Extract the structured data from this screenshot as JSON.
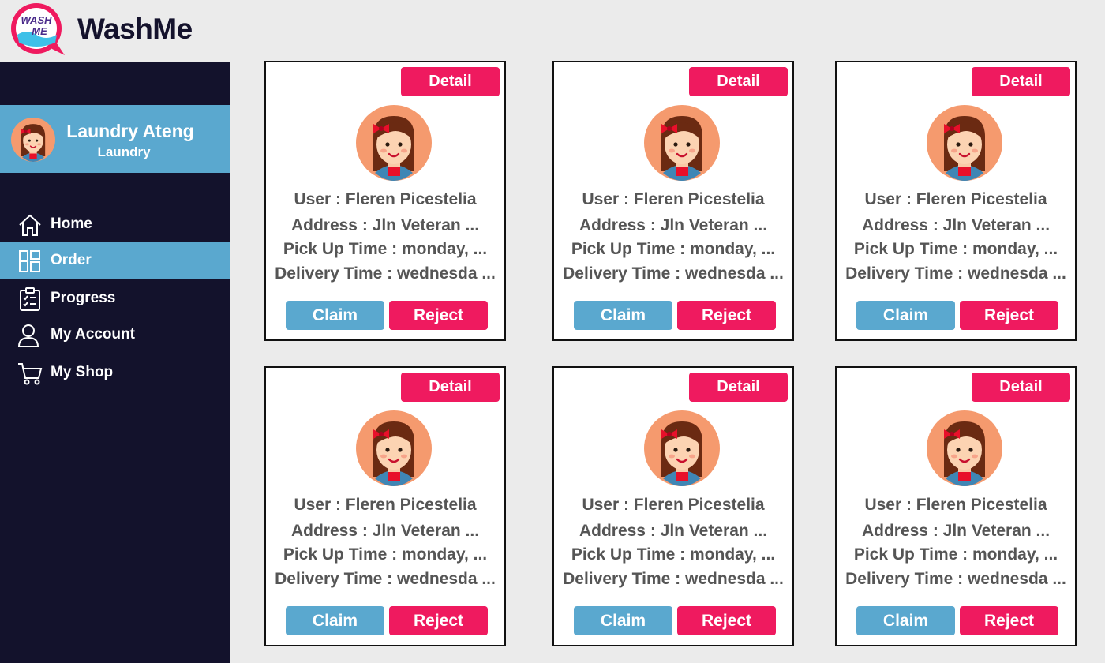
{
  "app": {
    "brand": "WashMe",
    "logo_text": "WASH ME"
  },
  "colors": {
    "sidebar_bg": "#13122c",
    "accent_blue": "#5aa8cf",
    "accent_pink": "#ef1a5f",
    "page_bg": "#ebebeb"
  },
  "profile": {
    "name": "Laundry Ateng",
    "role": "Laundry"
  },
  "nav": {
    "items": [
      {
        "label": "Home",
        "icon": "home-icon",
        "active": false
      },
      {
        "label": "Order",
        "icon": "dashboard-icon",
        "active": true
      },
      {
        "label": "Progress",
        "icon": "clipboard-icon",
        "active": false
      },
      {
        "label": "My Account",
        "icon": "user-icon",
        "active": false
      },
      {
        "label": "My Shop",
        "icon": "cart-icon",
        "active": false
      }
    ]
  },
  "orders": [
    {
      "detail_label": "Detail",
      "user": "User : Fleren Picestelia",
      "address": "Address : Jln Veteran ...",
      "pickup": "Pick Up Time : monday, ...",
      "delivery": "Delivery Time : wednesda ...",
      "claim_label": "Claim",
      "reject_label": "Reject"
    },
    {
      "detail_label": "Detail",
      "user": "User : Fleren Picestelia",
      "address": "Address : Jln Veteran ...",
      "pickup": "Pick Up Time : monday, ...",
      "delivery": "Delivery Time : wednesda ...",
      "claim_label": "Claim",
      "reject_label": "Reject"
    },
    {
      "detail_label": "Detail",
      "user": "User : Fleren Picestelia",
      "address": "Address : Jln Veteran ...",
      "pickup": "Pick Up Time : monday, ...",
      "delivery": "Delivery Time : wednesda ...",
      "claim_label": "Claim",
      "reject_label": "Reject"
    },
    {
      "detail_label": "Detail",
      "user": "User : Fleren Picestelia",
      "address": "Address : Jln Veteran ...",
      "pickup": "Pick Up Time : monday, ...",
      "delivery": "Delivery Time : wednesda ...",
      "claim_label": "Claim",
      "reject_label": "Reject"
    },
    {
      "detail_label": "Detail",
      "user": "User : Fleren Picestelia",
      "address": "Address : Jln Veteran ...",
      "pickup": "Pick Up Time : monday, ...",
      "delivery": "Delivery Time : wednesda ...",
      "claim_label": "Claim",
      "reject_label": "Reject"
    },
    {
      "detail_label": "Detail",
      "user": "User : Fleren Picestelia",
      "address": "Address : Jln Veteran ...",
      "pickup": "Pick Up Time : monday, ...",
      "delivery": "Delivery Time : wednesda ...",
      "claim_label": "Claim",
      "reject_label": "Reject"
    }
  ]
}
